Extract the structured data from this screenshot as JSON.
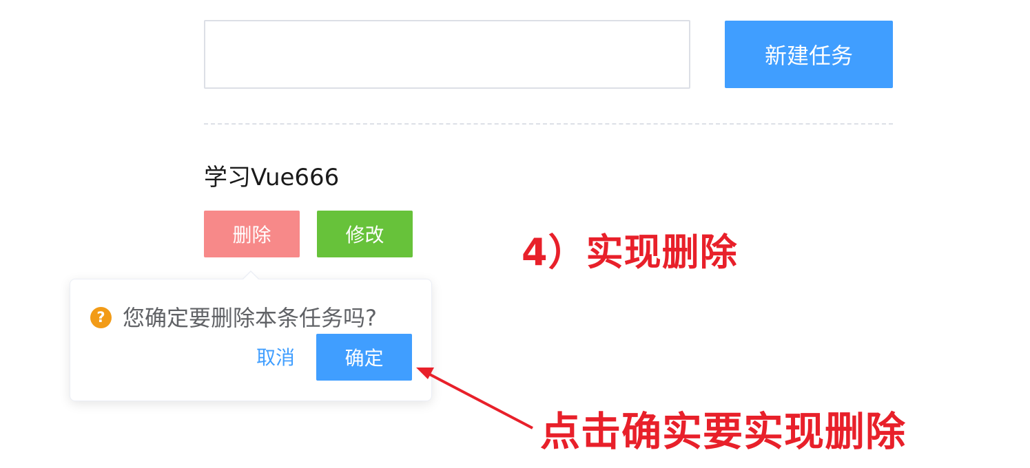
{
  "task_form": {
    "input_value": "",
    "create_button": "新建任务"
  },
  "task_item": {
    "title": "学习Vue666",
    "delete_button": "删除",
    "edit_button": "修改"
  },
  "popconfirm": {
    "icon": "question-circle-icon",
    "message": "您确定要删除本条任务吗?",
    "cancel": "取消",
    "confirm": "确定"
  },
  "annotations": {
    "step": "4）实现删除",
    "hint": "点击确实要实现删除"
  },
  "colors": {
    "primary": "#409eff",
    "danger_plain": "#f78989",
    "success": "#67c23a",
    "warning": "#f29b17",
    "annotation": "#e8202a"
  }
}
